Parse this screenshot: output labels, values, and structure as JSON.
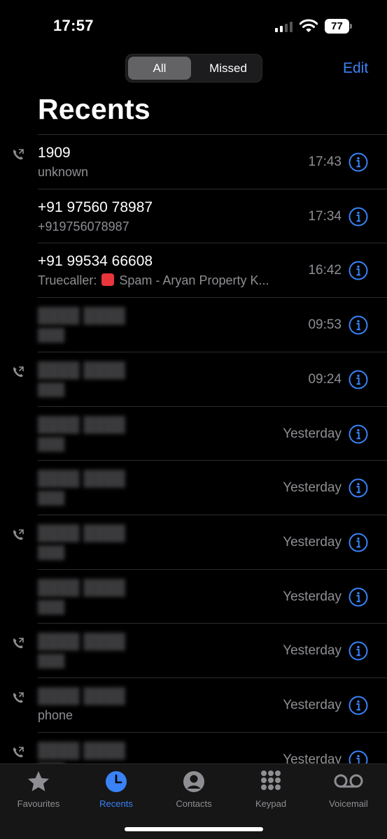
{
  "status": {
    "time": "17:57",
    "battery": "77"
  },
  "header": {
    "segments": [
      "All",
      "Missed"
    ],
    "selected_segment": "All",
    "edit_label": "Edit",
    "title": "Recents"
  },
  "calls": [
    {
      "name": "1909",
      "sub": "unknown",
      "time": "17:43",
      "outgoing": true,
      "redacted": false
    },
    {
      "name": "+91 97560 78987",
      "sub": "+919756078987",
      "time": "17:34",
      "outgoing": false,
      "redacted": false
    },
    {
      "name": "+91 99534 66608",
      "sub_prefix": "Truecaller:",
      "sub": "Spam - Aryan Property K...",
      "time": "16:42",
      "outgoing": false,
      "redacted": false,
      "spam": true
    },
    {
      "time": "09:53",
      "outgoing": false,
      "redacted": true
    },
    {
      "time": "09:24",
      "outgoing": true,
      "redacted": true
    },
    {
      "time": "Yesterday",
      "outgoing": false,
      "redacted": true
    },
    {
      "time": "Yesterday",
      "outgoing": false,
      "redacted": true
    },
    {
      "time": "Yesterday",
      "outgoing": true,
      "redacted": true
    },
    {
      "time": "Yesterday",
      "outgoing": false,
      "redacted": true
    },
    {
      "time": "Yesterday",
      "outgoing": true,
      "redacted": true
    },
    {
      "sub": "phone",
      "time": "Yesterday",
      "outgoing": true,
      "redacted": true
    },
    {
      "time": "Yesterday",
      "outgoing": true,
      "redacted": true
    }
  ],
  "tabs": [
    {
      "label": "Favourites",
      "icon": "star-icon",
      "active": false
    },
    {
      "label": "Recents",
      "icon": "clock-icon",
      "active": true
    },
    {
      "label": "Contacts",
      "icon": "person-icon",
      "active": false
    },
    {
      "label": "Keypad",
      "icon": "keypad-icon",
      "active": false
    },
    {
      "label": "Voicemail",
      "icon": "voicemail-icon",
      "active": false
    }
  ],
  "colors": {
    "accent": "#3a82f7",
    "secondary_text": "#8e8e93",
    "background": "#000000"
  }
}
